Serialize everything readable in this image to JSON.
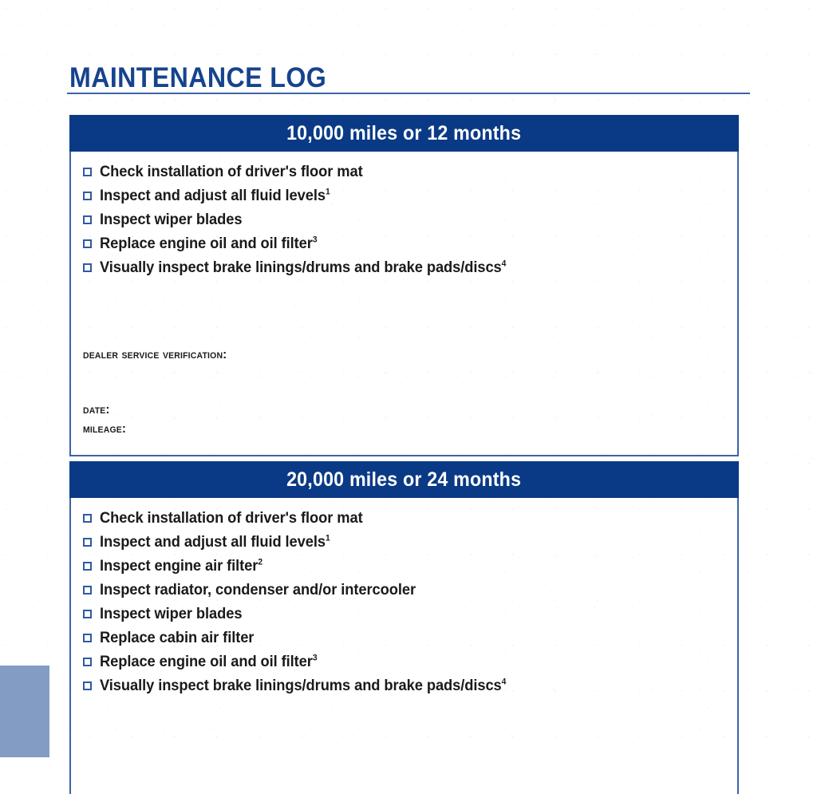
{
  "document": {
    "title": "MAINTENANCE LOG"
  },
  "sections": [
    {
      "header": "10,000 miles or 12 months",
      "items": [
        {
          "text": "Check installation of driver's floor mat",
          "note": ""
        },
        {
          "text": "Inspect and adjust all fluid levels",
          "note": "1"
        },
        {
          "text": "Inspect wiper blades",
          "note": ""
        },
        {
          "text": "Replace engine oil and oil filter",
          "note": "3"
        },
        {
          "text": "Visually inspect brake linings/drums and brake pads/discs",
          "note": "4"
        }
      ],
      "verification": {
        "title": "Dealer Service Verification:",
        "date_label": "Date:",
        "mileage_label": "Mileage:"
      }
    },
    {
      "header": "20,000 miles or 24 months",
      "items": [
        {
          "text": "Check installation of driver's floor mat",
          "note": ""
        },
        {
          "text": "Inspect and adjust all fluid levels",
          "note": "1"
        },
        {
          "text": "Inspect engine air filter",
          "note": "2"
        },
        {
          "text": "Inspect radiator, condenser and/or intercooler",
          "note": ""
        },
        {
          "text": "Inspect wiper blades",
          "note": ""
        },
        {
          "text": "Replace cabin air filter",
          "note": ""
        },
        {
          "text": "Replace engine oil and oil filter",
          "note": "3"
        },
        {
          "text": "Visually inspect brake linings/drums and brake pads/discs",
          "note": "4"
        }
      ],
      "verification": null
    }
  ],
  "colors": {
    "header_navy": "#0A3A85",
    "title_blue": "#16438E",
    "border_blue": "#3C63A4",
    "checkbox_blue": "#2F5BA0",
    "edge_block_blue": "#829CC4",
    "text_black": "#1A1A1A"
  }
}
